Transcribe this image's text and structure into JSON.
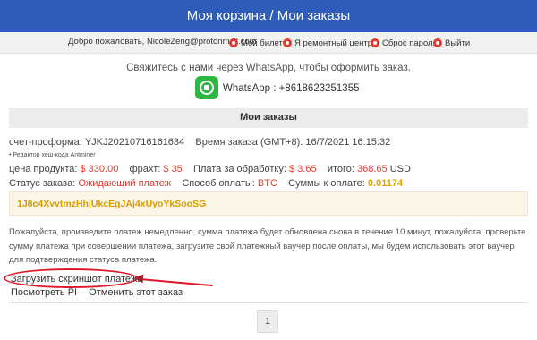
{
  "header": {
    "title": "Моя корзина / Мои заказы"
  },
  "userbar": {
    "welcome": "Добро пожаловать, NicoleZeng@protonmail.com",
    "links": [
      "Мой билет",
      "Я ремонтный центр",
      "Сброс пароля",
      "Выйти"
    ]
  },
  "contact": {
    "text": "Свяжитесь с нами через WhatsApp, чтобы оформить заказ.",
    "whatsapp": "WhatsApp : +8618623251355"
  },
  "orders": {
    "heading": "Мои заказы",
    "invoice_label": "счет-проформа:",
    "invoice_value": "YJKJ20210716161634",
    "time_label": "Время заказа (GMT+8):",
    "time_value": "16/7/2021 16:15:32",
    "product_note": "• Редактор хеш-кода Antminer",
    "price_label": "цена продукта:",
    "price_value": "$ 330.00",
    "freight_label": "фрахт:",
    "freight_value": "$ 35",
    "fee_label": "Плата за обработку:",
    "fee_value": "$ 3.65",
    "total_label": "итого:",
    "total_value": "368.65",
    "total_currency": "USD",
    "status_label": "Статус заказа:",
    "status_value": "Ожидающий платеж",
    "pay_method_label": "Способ оплаты:",
    "pay_method_value": "BTC",
    "pay_amount_label": "Суммы к оплате:",
    "pay_amount_value": "0.01174",
    "wallet": "1J8c4XvvtmzHhjUkcEgJAj4xUyoYkSooSG",
    "notice": "Пожалуйста, произведите платеж немедленно, сумма платежа будет обновлена снова в течение 10 минут, пожалуйста, проверьте сумму платежа при совершении платежа, загрузите свой платежный ваучер после оплаты, мы будем использовать этот ваучер для подтверждения статуса платежа.",
    "upload_link": "Загрузить скриншот платежа",
    "view_pi": "Посмотреть PI",
    "cancel_order": "Отменить этот заказ"
  },
  "pagination": {
    "current": "1"
  },
  "colors": {
    "header_bg": "#2e5cb8",
    "status_red": "#e23c30",
    "amount_orange": "#e0a400",
    "annotation_red": "#e0162b"
  },
  "icons": [
    "ticket-icon",
    "repair-center-icon",
    "reset-password-icon",
    "logout-icon",
    "whatsapp-icon"
  ]
}
